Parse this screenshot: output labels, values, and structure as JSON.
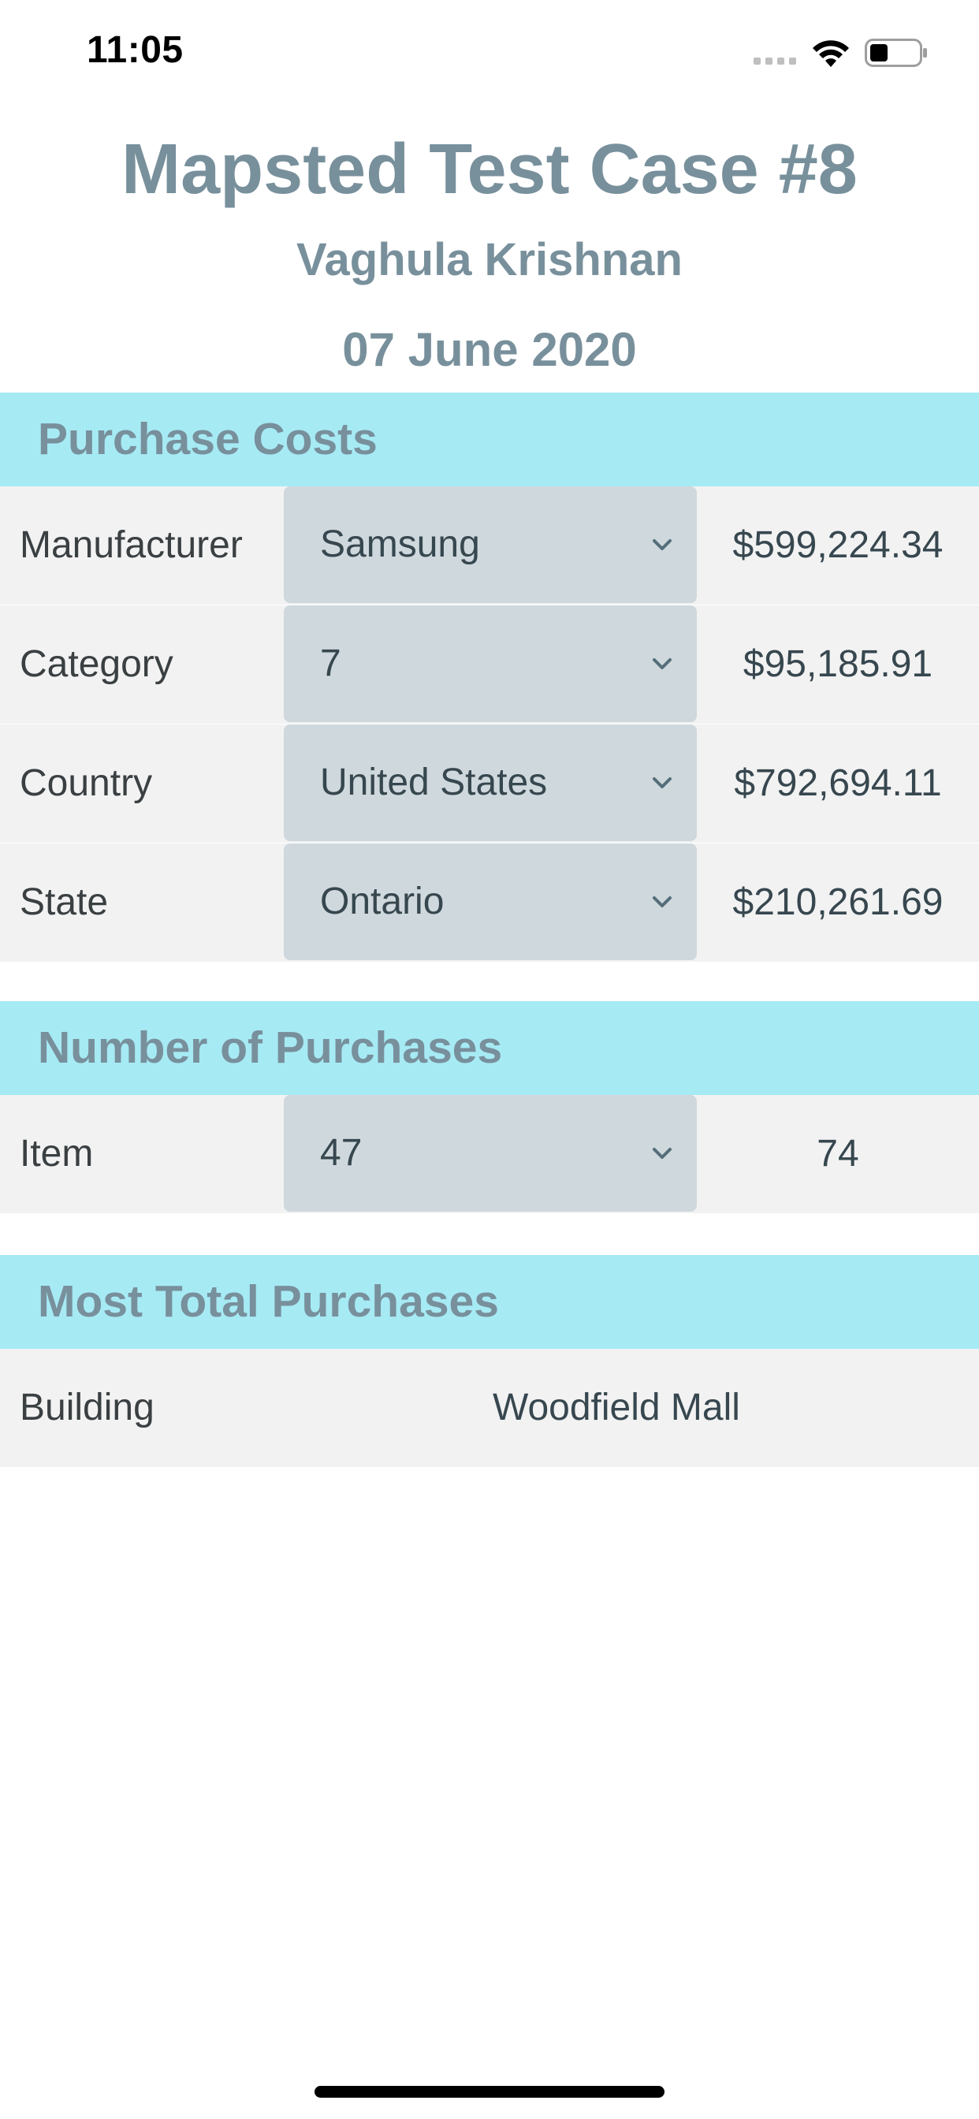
{
  "status_bar": {
    "time": "11:05"
  },
  "header": {
    "title": "Mapsted Test Case #8",
    "subtitle": "Vaghula Krishnan",
    "date": "07 June 2020"
  },
  "purchase_costs": {
    "title": "Purchase Costs",
    "rows": [
      {
        "label": "Manufacturer",
        "selected": "Samsung",
        "amount": "$599,224.34"
      },
      {
        "label": "Category",
        "selected": "7",
        "amount": "$95,185.91"
      },
      {
        "label": "Country",
        "selected": "United States",
        "amount": "$792,694.11"
      },
      {
        "label": "State",
        "selected": "Ontario",
        "amount": "$210,261.69"
      }
    ]
  },
  "number_of_purchases": {
    "title": "Number of Purchases",
    "rows": [
      {
        "label": "Item",
        "selected": "47",
        "amount": "74"
      }
    ]
  },
  "most_total_purchases": {
    "title": "Most Total Purchases",
    "rows": [
      {
        "label": "Building",
        "value": "Woodfield Mall"
      }
    ]
  },
  "icons": {
    "signal": "cellular-signal-icon",
    "wifi": "wifi-icon",
    "battery": "battery-icon",
    "dropdown": "chevron-down-icon"
  },
  "colors": {
    "section_header_bg": "#a6eaf4",
    "heading_text": "#78909c",
    "row_bg": "#f2f2f2",
    "select_bg": "#cfd8dc"
  }
}
